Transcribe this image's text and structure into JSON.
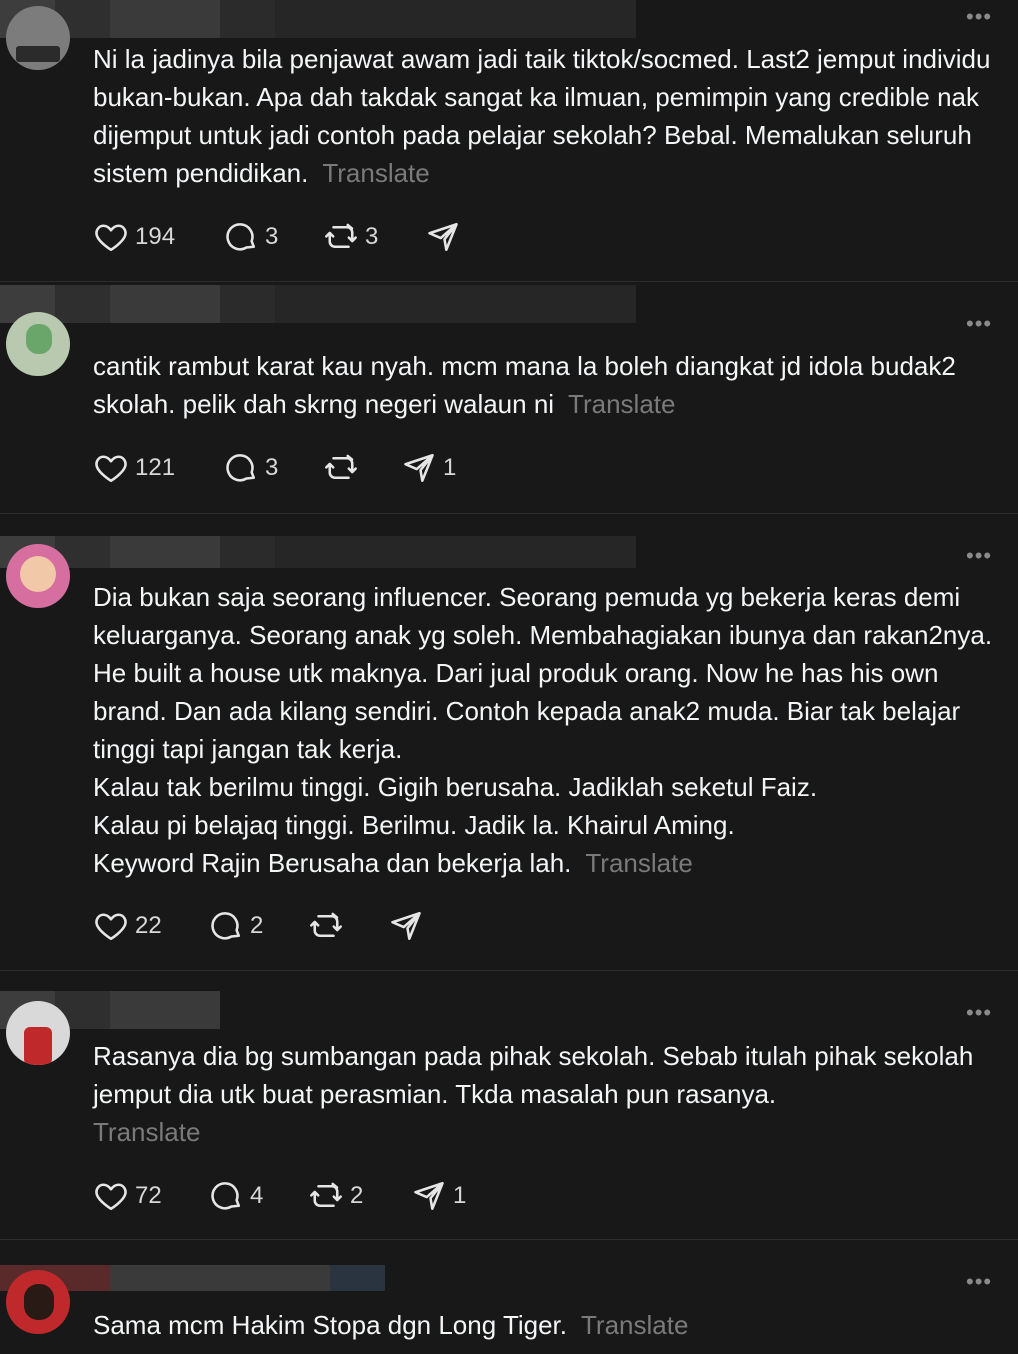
{
  "posts": [
    {
      "text": "Ni la jadinya bila penjawat awam jadi taik tiktok/socmed. Last2 jemput individu bukan-bukan. Apa dah takdak sangat ka ilmuan, pemimpin yang credible nak dijemput untuk jadi contoh pada pelajar sekolah? Bebal. Memalukan seluruh sistem pendidikan.",
      "translate": "Translate",
      "likes": "194",
      "replies": "3",
      "reposts": "3",
      "shares": ""
    },
    {
      "text": "cantik rambut karat kau nyah. mcm mana la boleh diangkat jd idola budak2 skolah. pelik dah skrng negeri walaun ni",
      "translate": "Translate",
      "likes": "121",
      "replies": "3",
      "reposts": "",
      "shares": "1"
    },
    {
      "text": "Dia bukan saja seorang influencer. Seorang pemuda yg bekerja keras demi keluarganya. Seorang anak yg soleh. Membahagiakan ibunya dan rakan2nya. He built a house utk maknya. Dari jual produk orang. Now he has his own brand. Dan ada kilang sendiri. Contoh kepada anak2 muda. Biar tak belajar tinggi tapi jangan tak kerja.\nKalau tak berilmu tinggi. Gigih berusaha. Jadiklah seketul Faiz.\nKalau pi belajaq tinggi. Berilmu. Jadik la. Khairul Aming.\nKeyword Rajin Berusaha dan bekerja lah.",
      "translate": "Translate",
      "likes": "22",
      "replies": "2",
      "reposts": "",
      "shares": ""
    },
    {
      "text": "Rasanya dia bg sumbangan pada pihak sekolah. Sebab itulah pihak sekolah jemput dia utk buat perasmian. Tkda masalah pun rasanya.",
      "translate": "Translate",
      "likes": "72",
      "replies": "4",
      "reposts": "2",
      "shares": "1"
    },
    {
      "text": "Sama mcm Hakim Stopa dgn Long Tiger.",
      "translate": "Translate",
      "likes": "",
      "replies": "",
      "reposts": "",
      "shares": ""
    }
  ],
  "ui": {
    "more_glyph": "•••"
  },
  "icons": {
    "like": "heart-icon",
    "reply": "comment-icon",
    "repost": "repost-icon",
    "share": "send-icon",
    "more": "more-icon"
  }
}
